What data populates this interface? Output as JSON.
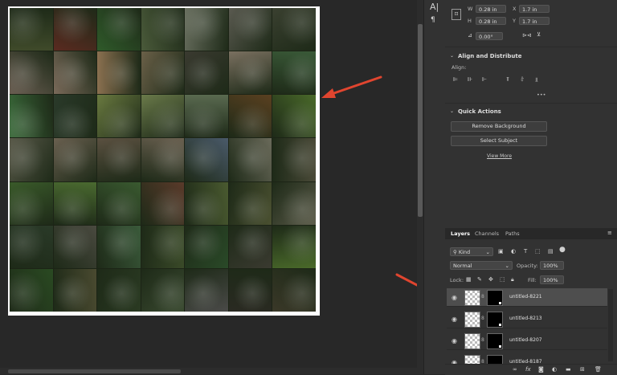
{
  "document": {
    "tile_colors": [
      [
        "#3f4a2a",
        "#5a2a20",
        "#2f5a2a",
        "#4a5a3a",
        "#6a7060",
        "#5a5a50",
        "#3a4030"
      ],
      [
        "#6a5e52",
        "#7a6a5a",
        "#8a7050",
        "#6a6048",
        "#3a3a30",
        "#7a7060",
        "#3a5a38"
      ],
      [
        "#3a6a3a",
        "#2a3a2a",
        "#6a7a40",
        "#6a7a4a",
        "#5a6a50",
        "#5a4020",
        "#4a6a2a"
      ],
      [
        "#5a5a4a",
        "#6a6050",
        "#5a5040",
        "#6a6050",
        "#4a5a6a",
        "#6a6a5a",
        "#4a4a38"
      ],
      [
        "#3a5a2a",
        "#4a6a30",
        "#3a5a30",
        "#5a3a2a",
        "#4a5a30",
        "#4a5030",
        "#5a5a48"
      ],
      [
        "#2a3a28",
        "#4a4a40",
        "#3a5a3a",
        "#3a4a28",
        "#2a4a28",
        "#3a3a30",
        "#4a6a2a"
      ],
      [
        "#2a4a22",
        "#4a4a30",
        "#2a3a22",
        "#3a4a30",
        "#4a4a48",
        "#2a2a22",
        "#3a3828"
      ]
    ]
  },
  "properties": {
    "w_label": "W",
    "w_value": "0.28 in",
    "x_label": "X",
    "x_value": "1.7 in",
    "h_label": "H",
    "h_value": "0.28 in",
    "y_label": "Y",
    "y_value": "1.7 in",
    "angle_value": "0.00°"
  },
  "align": {
    "title": "Align and Distribute",
    "align_label": "Align:",
    "more": "•••"
  },
  "quick_actions": {
    "title": "Quick Actions",
    "remove_bg": "Remove Background",
    "select_subject": "Select Subject",
    "view_more": "View More"
  },
  "layers_panel": {
    "tabs": [
      "Layers",
      "Channels",
      "Paths"
    ],
    "filter_value": "Kind",
    "blend_mode": "Normal",
    "opacity_label": "Opacity:",
    "opacity_value": "100%",
    "lock_label": "Lock:",
    "fill_label": "Fill:",
    "fill_value": "100%",
    "layers": [
      {
        "name": "untitled-8221"
      },
      {
        "name": "untitled-8213"
      },
      {
        "name": "untitled-8207"
      },
      {
        "name": "untitled-8187"
      }
    ],
    "bottom_icons": [
      "link-icon",
      "fx-icon",
      "mask-add-icon",
      "adjustment-icon",
      "folder-icon",
      "new-layer-icon",
      "trash-icon"
    ]
  },
  "colors": {
    "arrow": "#e0452f",
    "selected_row": "#4e4e4e"
  }
}
